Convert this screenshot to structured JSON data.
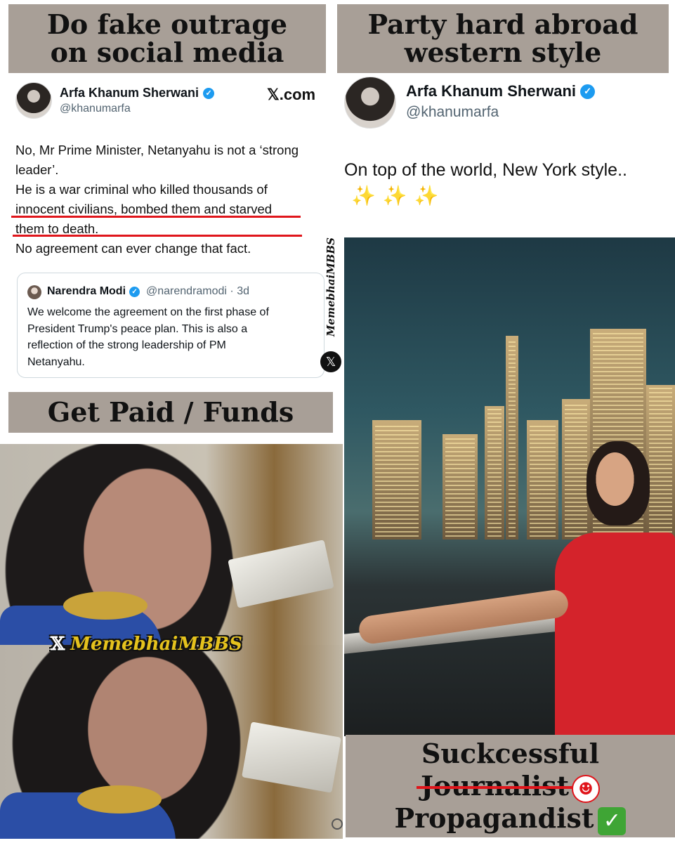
{
  "panels": {
    "top_left": {
      "banner": {
        "line1": "Do fake outrage",
        "line2": "on social media"
      },
      "tweet": {
        "name": "Arfa Khanum Sherwani",
        "verified_icon": "verified-badge-icon",
        "handle": "@khanumarfa",
        "source": "𝕏.com",
        "text_lines": [
          "No, Mr Prime Minister, Netanyahu is not a ‘strong",
          "leader’.",
          "He is a war criminal who killed thousands of",
          "innocent civilians, bombed them and starved",
          "them to death.",
          "No agreement can ever change that fact."
        ],
        "quote": {
          "name": "Narendra Modi",
          "handle": "@narendramodi · 3d",
          "text_lines": [
            "We welcome the agreement on the first phase of",
            "President Trump's peace plan. This is also a",
            "reflection of the strong leadership of PM",
            "Netanyahu."
          ]
        }
      }
    },
    "top_right": {
      "banner": {
        "line1": "Party hard abroad",
        "line2": "western style"
      },
      "tweet": {
        "name": "Arfa Khanum Sherwani",
        "handle": "@khanumarfa",
        "text": "On top of the world, New York style..",
        "sparkles": "✨✨✨"
      }
    },
    "middle_left": {
      "banner": "Get Paid / Funds",
      "watermark_x": "𝕏",
      "watermark": "MemebhaiMBBS"
    },
    "bottom_right": {
      "line1": "Suckcessful",
      "line2": "Journalist",
      "line3": "Propagandist",
      "clown_icon": "clown-face-icon",
      "check_icon": "check-mark-icon"
    }
  },
  "vertical_watermark": {
    "text": "MemebhaiMBBS",
    "x_icon": "𝕏"
  },
  "colors": {
    "banner_bg": "#a89f97",
    "underline_red": "#e0151b",
    "verified_blue": "#1d9bf0",
    "watermark_yellow": "#e5c21d"
  }
}
